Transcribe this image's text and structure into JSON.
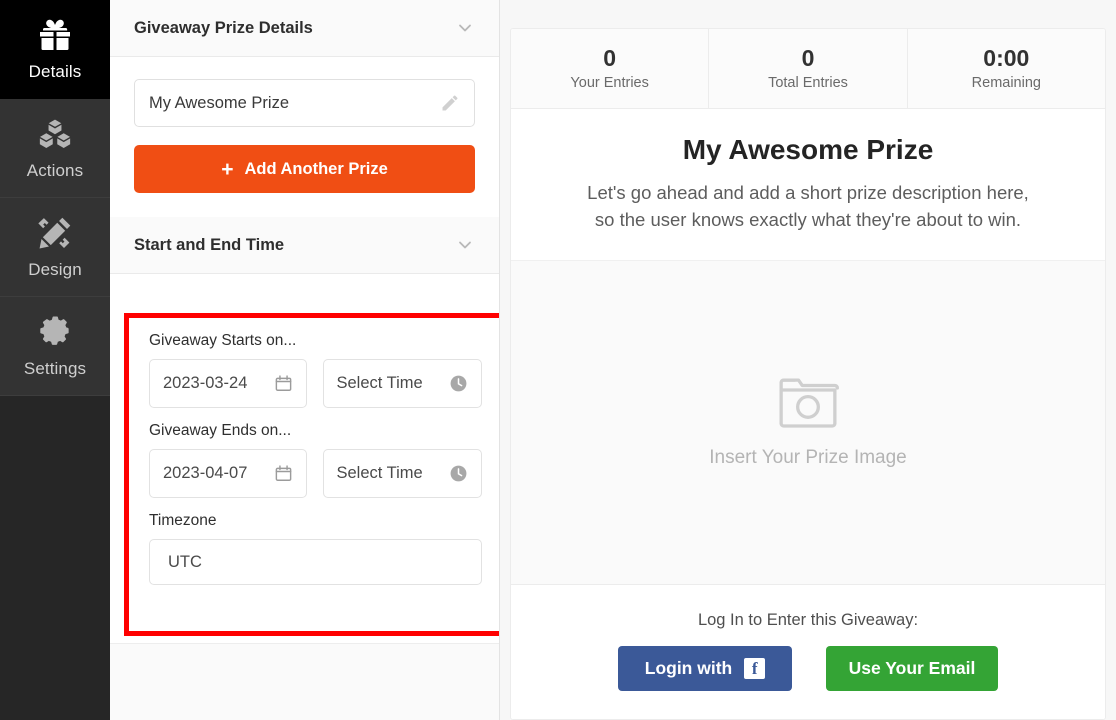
{
  "sidebar": {
    "items": [
      {
        "label": "Details",
        "icon": "gift-icon",
        "active": true
      },
      {
        "label": "Actions",
        "icon": "blocks-icon",
        "active": false
      },
      {
        "label": "Design",
        "icon": "pencil-ruler-icon",
        "active": false
      },
      {
        "label": "Settings",
        "icon": "gear-icon",
        "active": false
      }
    ]
  },
  "editor": {
    "prize_section": {
      "title": "Giveaway Prize Details",
      "collapse_icon": "chevron-down-icon",
      "prize_name_value": "My Awesome Prize",
      "prize_name_placeholder": "My Awesome Prize",
      "edit_icon": "pencil-icon",
      "add_prize_label": "Add Another Prize",
      "add_prize_plus": "+"
    },
    "time_section": {
      "title": "Start and End Time",
      "collapse_icon": "chevron-down-icon",
      "starts_label": "Giveaway Starts on...",
      "start_date_value": "2023-03-24",
      "start_time_value": "Select Time",
      "ends_label": "Giveaway Ends on...",
      "end_date_value": "2023-04-07",
      "end_time_value": "Select Time",
      "timezone_label": "Timezone",
      "timezone_value": "UTC",
      "calendar_icon": "calendar-icon",
      "clock_icon": "clock-icon",
      "highlight_color": "#ff0000"
    }
  },
  "preview": {
    "stats": [
      {
        "value": "0",
        "label": "Your Entries"
      },
      {
        "value": "0",
        "label": "Total Entries"
      },
      {
        "value": "0:00",
        "label": "Remaining"
      }
    ],
    "prize_title": "My Awesome Prize",
    "prize_description_line1": "Let's go ahead and add a short prize description here,",
    "prize_description_line2": "so the user knows exactly what they're about to win.",
    "image_drop": {
      "icon": "camera-icon",
      "text": "Insert Your Prize Image"
    },
    "login": {
      "prompt": "Log In to Enter this Giveaway:",
      "facebook_label": "Login with",
      "facebook_icon": "facebook-icon",
      "email_label": "Use Your Email"
    }
  },
  "colors": {
    "accent_orange": "#f04e14",
    "facebook_blue": "#3b5998",
    "email_green": "#34a435",
    "sidebar_bg": "#333333",
    "sidebar_active_bg": "#000000",
    "highlight_red": "#ff0000"
  }
}
